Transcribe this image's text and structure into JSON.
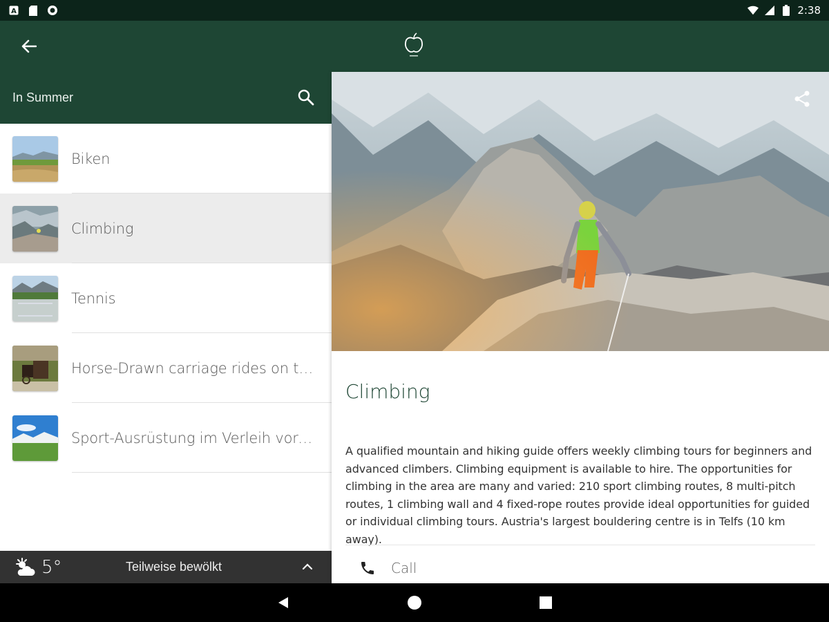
{
  "status_bar": {
    "time": "2:38",
    "left_icons": [
      "a-icon",
      "sim-icon",
      "circle-icon"
    ],
    "right_icons": [
      "wifi-icon",
      "signal-icon",
      "battery-icon"
    ]
  },
  "app_bar": {
    "back_icon": "arrow-back-icon",
    "logo_icon": "apple-logo-icon"
  },
  "left_pane": {
    "header_title": "In Summer",
    "search_icon": "search-icon",
    "items": [
      {
        "label": "Biken",
        "selected": false
      },
      {
        "label": "Climbing",
        "selected": true
      },
      {
        "label": "Tennis",
        "selected": false
      },
      {
        "label": "Horse-Drawn carriage rides on the ...",
        "selected": false
      },
      {
        "label": "Sport-Ausrüstung im Verleih vorhan...",
        "selected": false
      }
    ]
  },
  "weather": {
    "icon": "partly-cloudy-icon",
    "temperature": "5°",
    "condition": "Teilweise bewölkt",
    "expand_icon": "chevron-up-icon"
  },
  "detail": {
    "share_icon": "share-icon",
    "title": "Climbing",
    "description": "A qualified mountain and hiking guide offers weekly climbing tours for beginners and advanced climbers. Climbing equipment is available to hire. The opportunities for climbing in the area are many and varied: 210 sport climbing routes, 8 multi-pitch routes, 1 climbing wall and 4 fixed-rope routes provide ideal opportunities for guided or individual climbing tours. Austria's largest bouldering centre is in Telfs (10 km away).",
    "call_label": "Call",
    "call_icon": "phone-icon"
  },
  "nav_bar": {
    "buttons": [
      "back-triangle-icon",
      "home-circle-icon",
      "recents-square-icon"
    ]
  },
  "colors": {
    "primary": "#1e4634",
    "status_bar": "#0c241a",
    "weather_bar": "#323232",
    "selected_row": "#ececec"
  }
}
